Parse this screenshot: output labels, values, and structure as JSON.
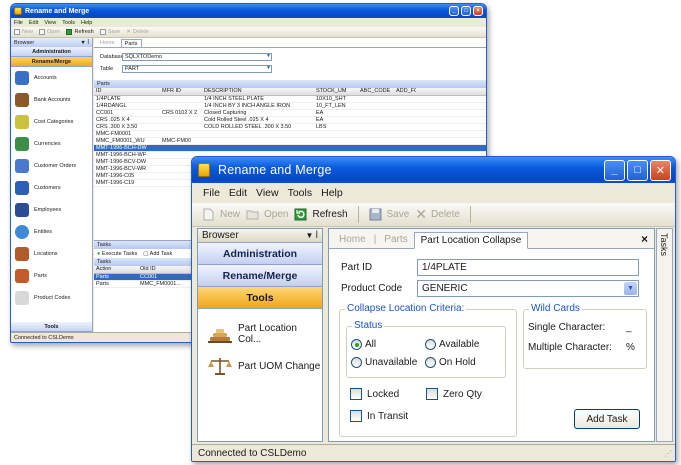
{
  "back_window": {
    "title": "Rename and Merge",
    "menu": [
      "File",
      "Edit",
      "View",
      "Tools",
      "Help"
    ],
    "toolbar": {
      "new": "New",
      "open": "Open",
      "refresh": "Refresh",
      "save": "Save",
      "delete": "Delete"
    },
    "browser_label": "Browser",
    "sections": {
      "administration": "Administration",
      "rename_merge": "Rename/Merge",
      "tools": "Tools"
    },
    "sidebar_items": [
      "Accounts",
      "Bank Accounts",
      "Cost Categories",
      "Currencies",
      "Customer Orders",
      "Customers",
      "Employees",
      "Entities",
      "Locations",
      "Parts",
      "Product Codes"
    ],
    "tabs": [
      "Home",
      "Parts"
    ],
    "form": {
      "database_label": "Database",
      "database_value": "SQLXTODemo",
      "table_label": "Table",
      "table_value": "PART"
    },
    "grid_title": "Parts",
    "columns": [
      "ID",
      "MFR ID",
      "DESCRIPTION",
      "STOCK_UM",
      "ABC_CODE",
      "ADD_FO"
    ],
    "rows": [
      [
        "1/4PLATE",
        "",
        "1/4 INCH STEEL PLATE",
        "10X10_SHT",
        "",
        ""
      ],
      [
        "1/4RDANGL",
        "",
        "1/4 INCH BY 3 INCH ANGLE IRON",
        "10_FT_LEN",
        "",
        ""
      ],
      [
        "CC001",
        "CRS 0102 X 2",
        "Closed Capturing",
        "EA",
        "",
        ""
      ],
      [
        "CRS .025 X 4",
        "",
        "Cold Rolled Steel .025 X 4",
        "EA",
        "",
        ""
      ],
      [
        "CRS .300 X 3.50",
        "",
        "COLD ROLLED STEEL .300 X 3.50",
        "LBS",
        "",
        ""
      ],
      [
        "MMC-FM0001",
        "",
        "",
        "",
        "",
        ""
      ],
      [
        "MMC_FM0001_WU",
        "MMC-FM00",
        "",
        "",
        "",
        ""
      ],
      [
        "MMT-1996-BCH-DW",
        "",
        "",
        "",
        "",
        ""
      ],
      [
        "MMT-1996-BCH-WF",
        "",
        "",
        "",
        "",
        ""
      ],
      [
        "MMT-1996-BCV-DW",
        "",
        "",
        "",
        "",
        ""
      ],
      [
        "MMT-1996-BCV-WR",
        "",
        "",
        "",
        "",
        ""
      ],
      [
        "MMT-1996-C05",
        "",
        "",
        "",
        "",
        ""
      ],
      [
        "MMT-1996-C19",
        "",
        "",
        "",
        "",
        ""
      ]
    ],
    "tasks_title": "Tasks",
    "tasks_toolbar": [
      "Execute Tasks",
      "Add Task"
    ],
    "tasks_subtitle": "Tasks",
    "tasks_columns": [
      "Action",
      "Old ID"
    ],
    "tasks_rows": [
      [
        "Parts",
        "CC001"
      ],
      [
        "Parts",
        "MMC_FM0001..."
      ]
    ],
    "status": "Connected to CSLDemo"
  },
  "front_window": {
    "title": "Rename and Merge",
    "menu": {
      "file": "File",
      "edit": "Edit",
      "view": "View",
      "tools": "Tools",
      "help": "Help"
    },
    "toolbar": {
      "new": "New",
      "open": "Open",
      "refresh": "Refresh",
      "save": "Save",
      "delete": "Delete"
    },
    "browser": {
      "label": "Browser",
      "pin": "▼ ꟾ",
      "sections": {
        "administration": "Administration",
        "rename_merge": "Rename/Merge",
        "tools": "Tools"
      },
      "items": [
        "Part Location Col...",
        "Part UOM Change"
      ]
    },
    "tabs": {
      "home": "Home",
      "parts": "Parts",
      "active": "Part Location Collapse",
      "close": "×"
    },
    "fields": {
      "part_id_label": "Part ID",
      "part_id_value": "1/4PLATE",
      "product_code_label": "Product Code",
      "product_code_value": "GENERIC"
    },
    "criteria": {
      "title": "Collapse Location Criteria:",
      "status_title": "Status",
      "radios": {
        "all": "All",
        "available": "Available",
        "unavailable": "Unavailable",
        "on_hold": "On Hold"
      },
      "selected": "all",
      "checks": {
        "locked": "Locked",
        "zero_qty": "Zero Qty",
        "in_transit": "In Transit"
      }
    },
    "wildcards": {
      "title": "Wild Cards",
      "single_label": "Single Character:",
      "single_value": "_",
      "multiple_label": "Multiple Character:",
      "multiple_value": "%"
    },
    "add_task": "Add Task",
    "tasks_side": "Tasks",
    "status": "Connected to CSLDemo"
  },
  "colors": {
    "title_blue": "#0a5bdd",
    "active_section": "#f0a419",
    "group_title": "#1a56c4",
    "selection": "#316ac5"
  }
}
